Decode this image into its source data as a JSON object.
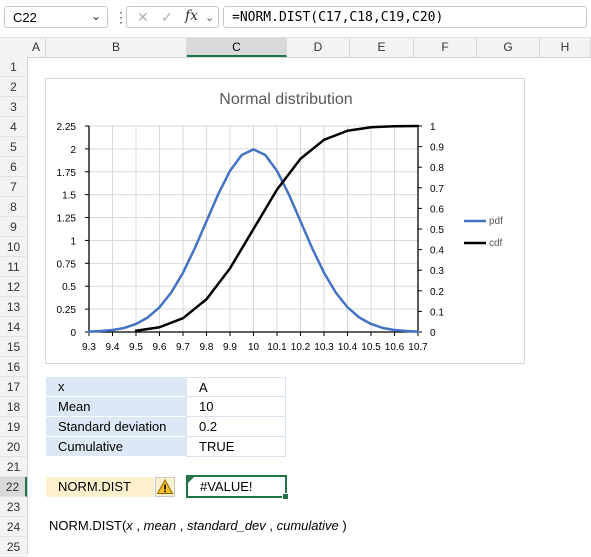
{
  "formula_bar": {
    "name_box": "C22",
    "formula": "=NORM.DIST(C17,C18,C19,C20)",
    "fx_label": "fx"
  },
  "columns": [
    "A",
    "B",
    "C",
    "D",
    "E",
    "F",
    "G",
    "H"
  ],
  "selected_column": "C",
  "rows": [
    "1",
    "2",
    "3",
    "4",
    "5",
    "6",
    "7",
    "8",
    "9",
    "10",
    "11",
    "12",
    "13",
    "14",
    "15",
    "16",
    "17",
    "18",
    "19",
    "20",
    "21",
    "22",
    "23",
    "24",
    "25"
  ],
  "selected_row": "22",
  "table": {
    "rows": [
      {
        "label": "x",
        "value": "A"
      },
      {
        "label": "Mean",
        "value": "10"
      },
      {
        "label": "Standard deviation",
        "value": "0.2"
      },
      {
        "label": "Cumulative",
        "value": "TRUE"
      }
    ]
  },
  "function_cell": {
    "label": "NORM.DIST",
    "result": "#VALUE!"
  },
  "syntax": {
    "fn": "NORM.DIST(",
    "args": [
      {
        "text": "x",
        "italic": true
      },
      {
        "text": " , ",
        "italic": false
      },
      {
        "text": "mean",
        "italic": true
      },
      {
        "text": " , ",
        "italic": false
      },
      {
        "text": "standard_dev",
        "italic": true
      },
      {
        "text": " , ",
        "italic": false
      },
      {
        "text": "cumulative",
        "italic": true
      },
      {
        "text": " )",
        "italic": false
      }
    ]
  },
  "chart_data": {
    "type": "line",
    "title": "Normal distribution",
    "x_tick_labels": [
      "9.3",
      "9.4",
      "9.5",
      "9.6",
      "9.7",
      "9.8",
      "9.9",
      "10",
      "10.1",
      "10.2",
      "10.3",
      "10.4",
      "10.5",
      "10.6",
      "10.7"
    ],
    "y_left_ticks": [
      "0",
      "0.25",
      "0.5",
      "0.75",
      "1",
      "1.25",
      "1.5",
      "1.75",
      "2",
      "2.25"
    ],
    "y_right_ticks": [
      "0",
      "0.1",
      "0.2",
      "0.3",
      "0.4",
      "0.5",
      "0.6",
      "0.7",
      "0.8",
      "0.9",
      "1"
    ],
    "ylim_left": [
      0,
      2.25
    ],
    "ylim_right": [
      0,
      1
    ],
    "xlim": [
      9.3,
      10.7
    ],
    "grid": true,
    "legend_position": "right",
    "series": [
      {
        "name": "pdf",
        "axis": "left",
        "color": "#4472c4",
        "x": [
          9.3,
          9.35,
          9.4,
          9.45,
          9.5,
          9.55,
          9.6,
          9.65,
          9.7,
          9.75,
          9.8,
          9.85,
          9.9,
          9.95,
          10,
          10.05,
          10.1,
          10.15,
          10.2,
          10.25,
          10.3,
          10.35,
          10.4,
          10.45,
          10.5,
          10.55,
          10.6,
          10.65,
          10.7
        ],
        "y": [
          0.0044,
          0.011,
          0.0222,
          0.0438,
          0.0876,
          0.1587,
          0.27,
          0.4318,
          0.6476,
          0.9132,
          1.2099,
          1.5058,
          1.7603,
          1.9333,
          1.9947,
          1.9333,
          1.7603,
          1.5058,
          1.2099,
          0.9132,
          0.6476,
          0.4318,
          0.27,
          0.1587,
          0.0876,
          0.0438,
          0.0222,
          0.011,
          0.0044
        ]
      },
      {
        "name": "cdf",
        "axis": "right",
        "color": "#000000",
        "x": [
          9.5,
          9.6,
          9.7,
          9.8,
          9.9,
          10,
          10.1,
          10.2,
          10.3,
          10.4,
          10.5,
          10.6,
          10.7
        ],
        "y": [
          0.006,
          0.023,
          0.067,
          0.159,
          0.309,
          0.5,
          0.691,
          0.841,
          0.933,
          0.977,
          0.994,
          0.999,
          1.0
        ]
      }
    ]
  }
}
